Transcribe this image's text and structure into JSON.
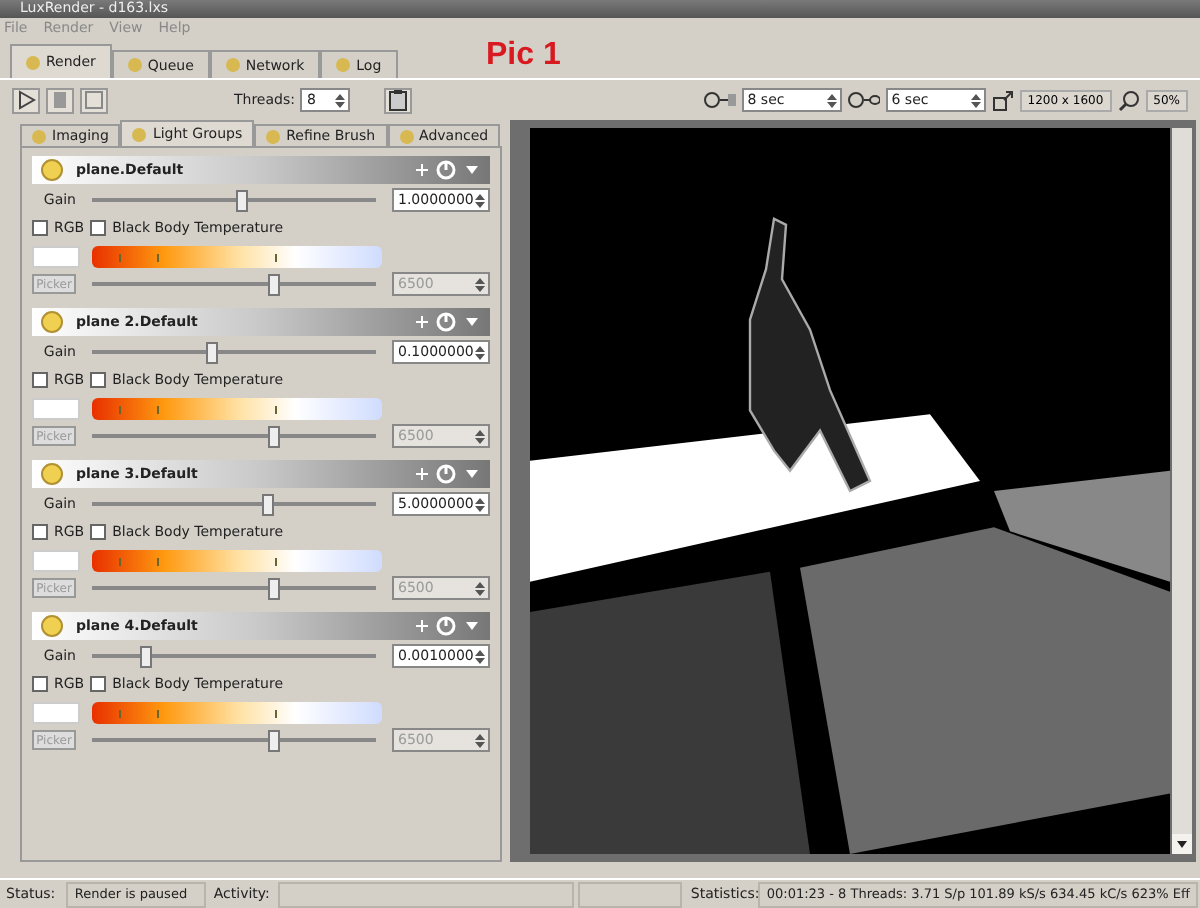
{
  "window": {
    "title": "LuxRender - d163.lxs"
  },
  "menu": [
    "File",
    "Render",
    "View",
    "Help"
  ],
  "tabs": [
    {
      "label": "Render",
      "selected": true
    },
    {
      "label": "Queue",
      "selected": false
    },
    {
      "label": "Network",
      "selected": false
    },
    {
      "label": "Log",
      "selected": false
    }
  ],
  "annotation": "Pic 1",
  "toolbar": {
    "threads_label": "Threads:",
    "threads": "8",
    "halt_time": "8 sec",
    "display_interval": "6 sec",
    "resolution": "1200 x 1600",
    "zoom": "50%"
  },
  "subtabs": [
    {
      "label": "Imaging",
      "selected": false
    },
    {
      "label": "Light Groups",
      "selected": true
    },
    {
      "label": "Refine Brush",
      "selected": false
    },
    {
      "label": "Advanced",
      "selected": false
    }
  ],
  "light_groups": [
    {
      "name": "plane.Default",
      "gain_label": "Gain",
      "level": 0.53,
      "gain": "1.0000000",
      "rgb_label": "RGB",
      "rgb": false,
      "bbt_label": "Black Body Temperature",
      "bbt": false,
      "picker": "Picker",
      "temperature_slider": {
        "level": 0.64
      },
      "temperature": "6500"
    },
    {
      "name": "plane 2.Default",
      "gain_label": "Gain",
      "level": 0.42,
      "gain": "0.1000000",
      "rgb_label": "RGB",
      "rgb": false,
      "bbt_label": "Black Body Temperature",
      "bbt": false,
      "picker": "Picker",
      "temperature_slider": {
        "level": 0.64
      },
      "temperature": "6500"
    },
    {
      "name": "plane 3.Default",
      "gain_label": "Gain",
      "level": 0.62,
      "gain": "5.0000000",
      "rgb_label": "RGB",
      "rgb": false,
      "bbt_label": "Black Body Temperature",
      "bbt": false,
      "picker": "Picker",
      "temperature_slider": {
        "level": 0.64
      },
      "temperature": "6500"
    },
    {
      "name": "plane 4.Default",
      "gain_label": "Gain",
      "level": 0.19,
      "gain": "0.0010000",
      "rgb_label": "RGB",
      "rgb": false,
      "bbt_label": "Black Body Temperature",
      "bbt": false,
      "picker": "Picker",
      "temperature_slider": {
        "level": 0.64
      },
      "temperature": "6500"
    }
  ],
  "status_bar": {
    "status_label": "Status:",
    "status": "Render is paused",
    "activity_label": "Activity:",
    "statistics_label": "Statistics:",
    "statistics": "00:01:23 - 8 Threads: 3.71 S/p 101.89 kS/s 634.45 kC/s 623% Eff"
  }
}
